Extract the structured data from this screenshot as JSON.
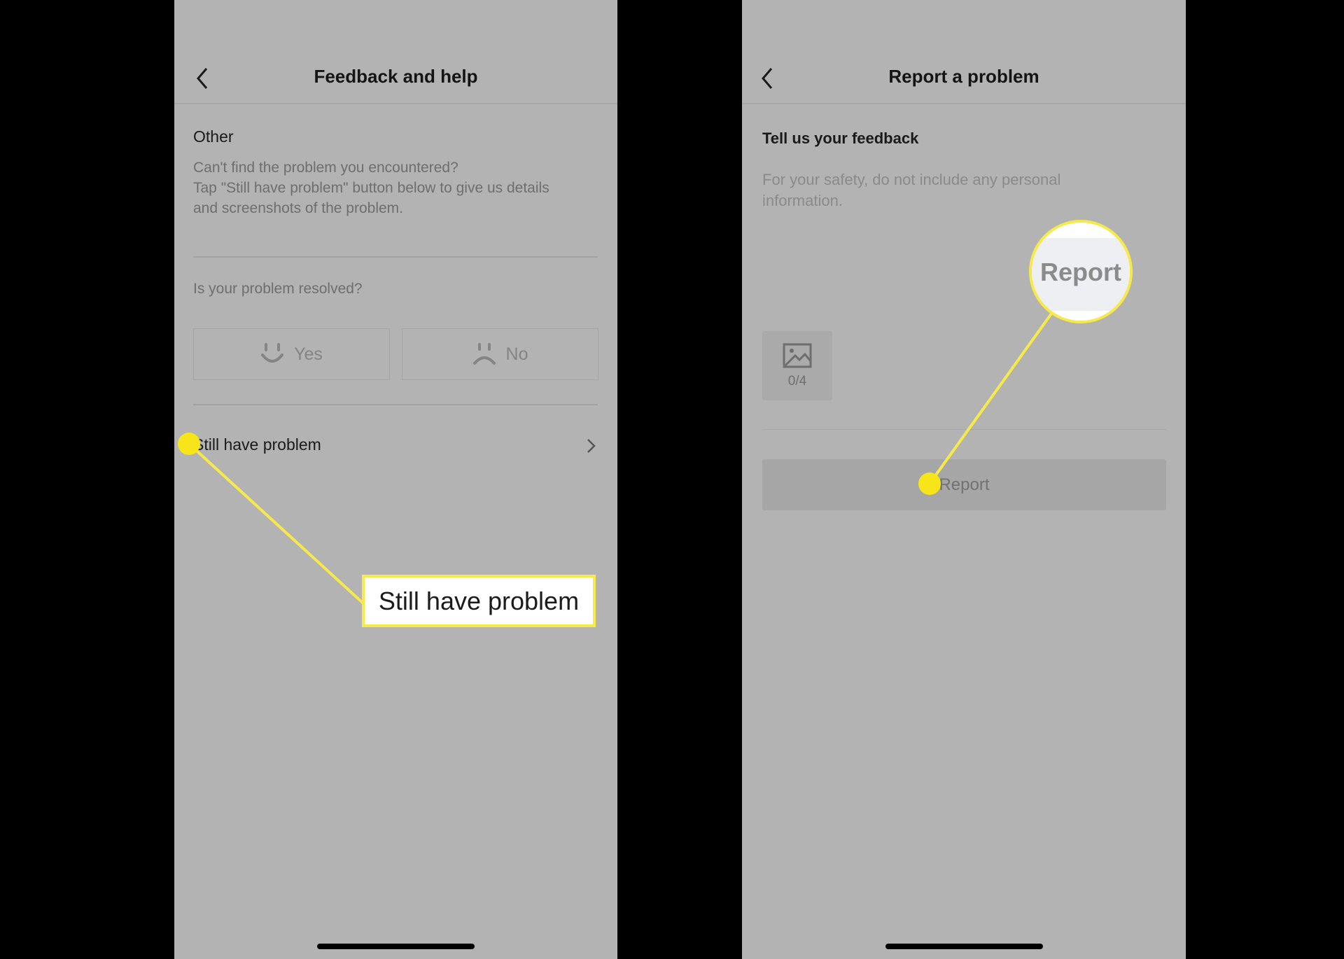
{
  "left_screen": {
    "title": "Feedback and help",
    "section_title": "Other",
    "description_line1": "Can't find the problem you encountered?",
    "description_line2": "Tap \"Still have problem\" button below to give us details",
    "description_line3": "and screenshots of the problem.",
    "question": "Is your problem resolved?",
    "yes_label": "Yes",
    "no_label": "No",
    "still_have_problem_label": "Still have problem",
    "callout_label": "Still have problem"
  },
  "right_screen": {
    "title": "Report a problem",
    "section_title": "Tell us your feedback",
    "placeholder_line1": "For your safety, do not include any personal",
    "placeholder_line2": "information.",
    "image_count": "0/4",
    "report_button_label": "Report",
    "magnifier_label": "Report"
  },
  "colors": {
    "highlight": "#f6e94a",
    "screen_bg": "#b3b3b3"
  }
}
